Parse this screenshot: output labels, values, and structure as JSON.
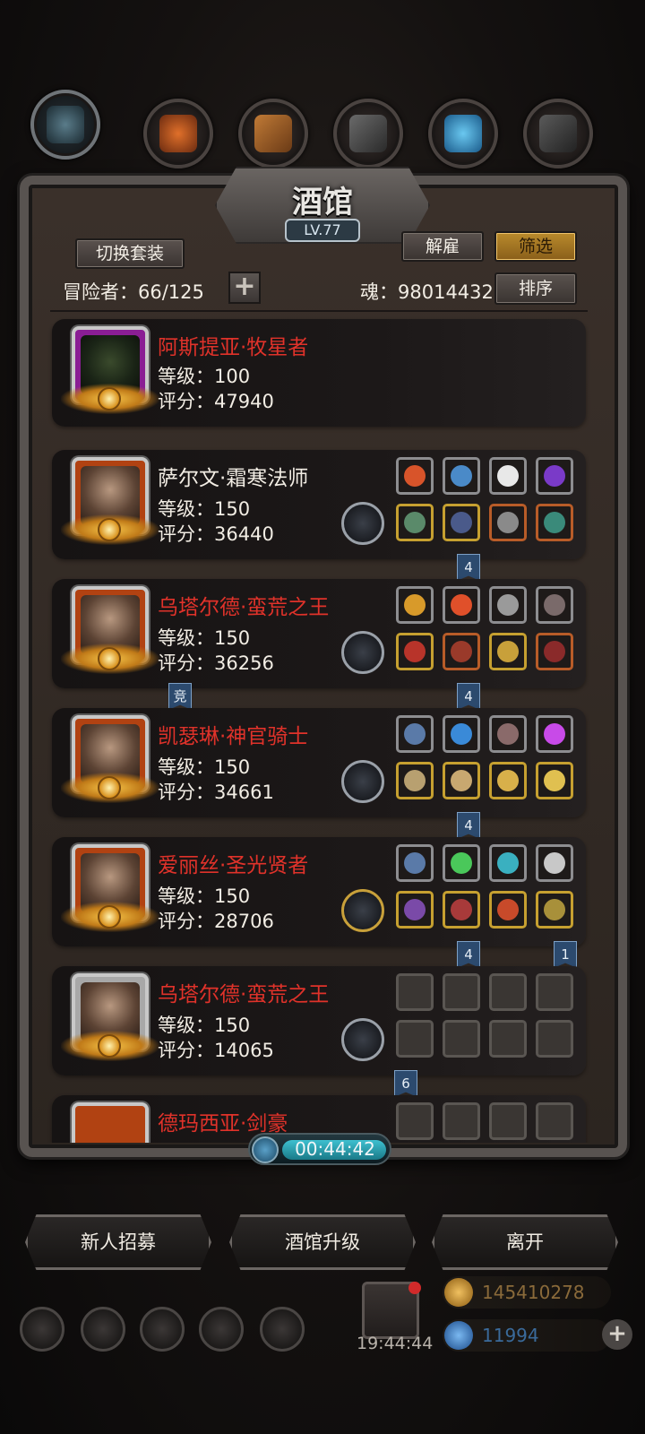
{
  "window": {
    "title": "酒馆",
    "level": "LV.77"
  },
  "buttons": {
    "switch_set": "切换套装",
    "dismiss": "解雇",
    "filter": "筛选",
    "sort": "排序",
    "add": "+"
  },
  "stats": {
    "adventurer_label": "冒险者：66/125",
    "soul_label": "魂：98014432"
  },
  "heroes": [
    {
      "name": "阿斯提亚·牧星者",
      "name_color": "red",
      "level": "等级：100",
      "score": "评分：47940",
      "frame": "purple"
    },
    {
      "name": "萨尔文·霜寒法师",
      "name_color": "white",
      "level": "等级：150",
      "score": "评分：36440",
      "tag_equip": "4"
    },
    {
      "name": "乌塔尔德·蛮荒之王",
      "name_color": "red",
      "level": "等级：150",
      "score": "评分：36256",
      "tag_left": "竞",
      "tag_equip": "4"
    },
    {
      "name": "凯瑟琳·神官骑士",
      "name_color": "red",
      "level": "等级：150",
      "score": "评分：34661",
      "tag_equip": "4"
    },
    {
      "name": "爱丽丝·圣光贤者",
      "name_color": "red",
      "level": "等级：150",
      "score": "评分：28706",
      "tag_equip": "4",
      "tag_right": "1"
    },
    {
      "name": "乌塔尔德·蛮荒之王",
      "name_color": "red",
      "level": "等级：150",
      "score": "评分：14065",
      "tag_mid": "6"
    },
    {
      "name": "德玛西亚·剑豪",
      "name_color": "red"
    }
  ],
  "timer": {
    "value": "00:44:42"
  },
  "bottom": {
    "recruit": "新人招募",
    "upgrade": "酒馆升级",
    "leave": "离开"
  },
  "hud": {
    "clock": "19:44:44",
    "gold": "145410278",
    "gems": "11994"
  },
  "colors": {
    "accent_gold": "#c6a030",
    "name_red": "#e0322a",
    "timer_cyan": "#3ec0d0"
  },
  "icons": [
    "compass-icon",
    "ember-icon",
    "wood-icon",
    "anvil-icon",
    "crystal-icon",
    "chest-icon"
  ]
}
